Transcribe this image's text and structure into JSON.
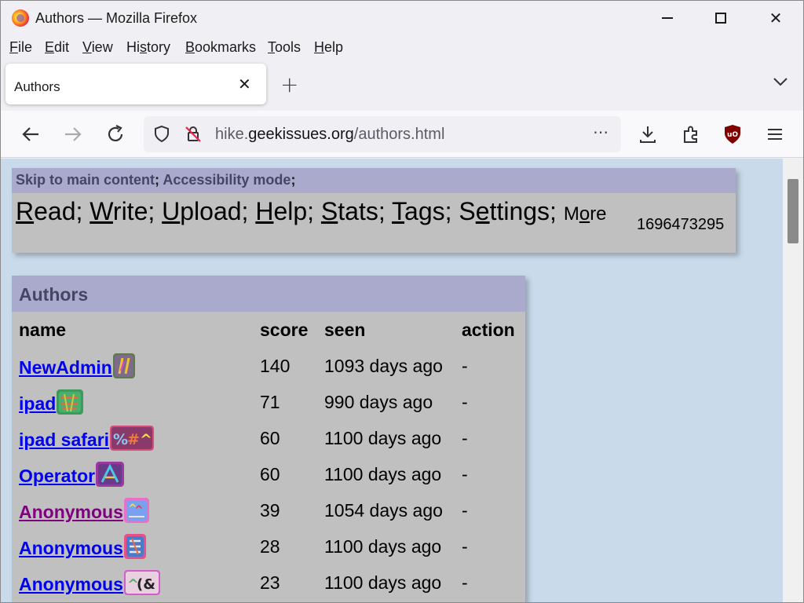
{
  "window": {
    "title": "Authors — Mozilla Firefox"
  },
  "menubar": [
    {
      "key": "F",
      "rest": "ile"
    },
    {
      "key": "E",
      "rest": "dit"
    },
    {
      "key": "V",
      "rest": "iew"
    },
    {
      "pre": "Hi",
      "key": "s",
      "rest": "tory"
    },
    {
      "key": "B",
      "rest": "ookmarks"
    },
    {
      "key": "T",
      "rest": "ools"
    },
    {
      "key": "H",
      "rest": "elp"
    }
  ],
  "tab": {
    "title": "Authors"
  },
  "urlbar": {
    "prefix": "hike.",
    "domain": "geekissues.org",
    "path": "/authors.html"
  },
  "site": {
    "skip_main": "Skip to main content",
    "sep1": ";",
    "accessibility": "Accessibility mode",
    "sep2": ";",
    "nav": [
      {
        "key": "R",
        "rest": "ead"
      },
      {
        "key": "W",
        "rest": "rite"
      },
      {
        "key": "U",
        "rest": "pload"
      },
      {
        "key": "H",
        "rest": "elp"
      },
      {
        "key": "S",
        "rest": "tats"
      },
      {
        "key": "T",
        "rest": "ags"
      },
      {
        "pre": "S",
        "key": "e",
        "rest": "ttings"
      }
    ],
    "more": {
      "pre": "M",
      "key": "o",
      "rest": "re"
    },
    "timestamp": "1696473295"
  },
  "authors": {
    "title": "Authors",
    "columns": [
      "name",
      "score",
      "seen",
      "action"
    ],
    "rows": [
      {
        "name": "NewAdmin",
        "score": "140",
        "seen": "1093 days ago",
        "action": "-",
        "visited": false
      },
      {
        "name": "ipad",
        "score": "71",
        "seen": "990 days ago",
        "action": "-",
        "visited": false
      },
      {
        "name": "ipad safari",
        "score": "60",
        "seen": "1100 days ago",
        "action": "-",
        "visited": false
      },
      {
        "name": "Operator",
        "score": "60",
        "seen": "1100 days ago",
        "action": "-",
        "visited": false
      },
      {
        "name": "Anonymous",
        "score": "39",
        "seen": "1054 days ago",
        "action": "-",
        "visited": true
      },
      {
        "name": "Anonymous",
        "score": "28",
        "seen": "1100 days ago",
        "action": "-",
        "visited": false
      },
      {
        "name": "Anonymous",
        "score": "23",
        "seen": "1100 days ago",
        "action": "-",
        "visited": false
      }
    ]
  },
  "colors": {
    "page_bg": "#c9daea",
    "block_bg": "#c0c0c0",
    "header_bg": "#aaaacc",
    "link": "#0000ee",
    "visited": "#800080"
  }
}
